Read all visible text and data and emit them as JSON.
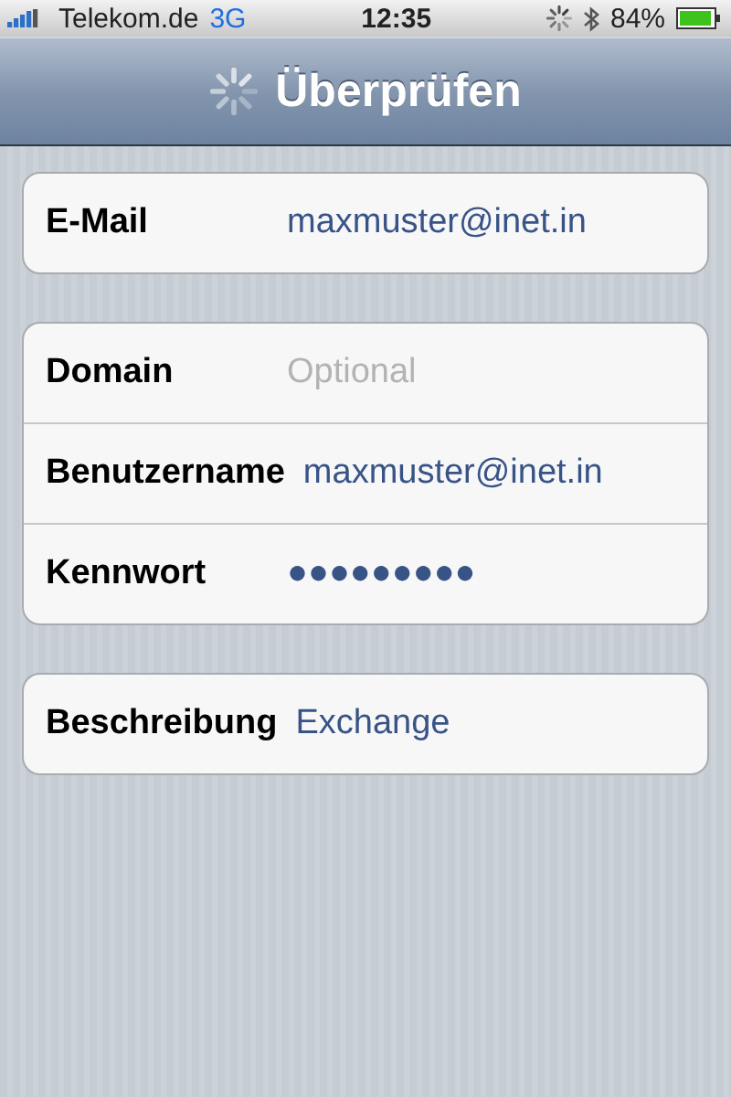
{
  "status_bar": {
    "carrier": "Telekom.de",
    "network": "3G",
    "time": "12:35",
    "battery": "84%"
  },
  "nav_bar": {
    "title": "Überprüfen",
    "loading": true
  },
  "groups": [
    {
      "fields": [
        {
          "label": "E-Mail",
          "value": "maxmuster@inet.in"
        }
      ]
    },
    {
      "fields": [
        {
          "label": "Domain",
          "placeholder": "Optional"
        },
        {
          "label": "Benutzername",
          "value": "maxmuster@inet.in"
        },
        {
          "label": "Kennwort",
          "value": "●●●●●●●●●"
        }
      ]
    },
    {
      "fields": [
        {
          "label": "Beschreibung",
          "value": "Exchange"
        }
      ]
    }
  ]
}
